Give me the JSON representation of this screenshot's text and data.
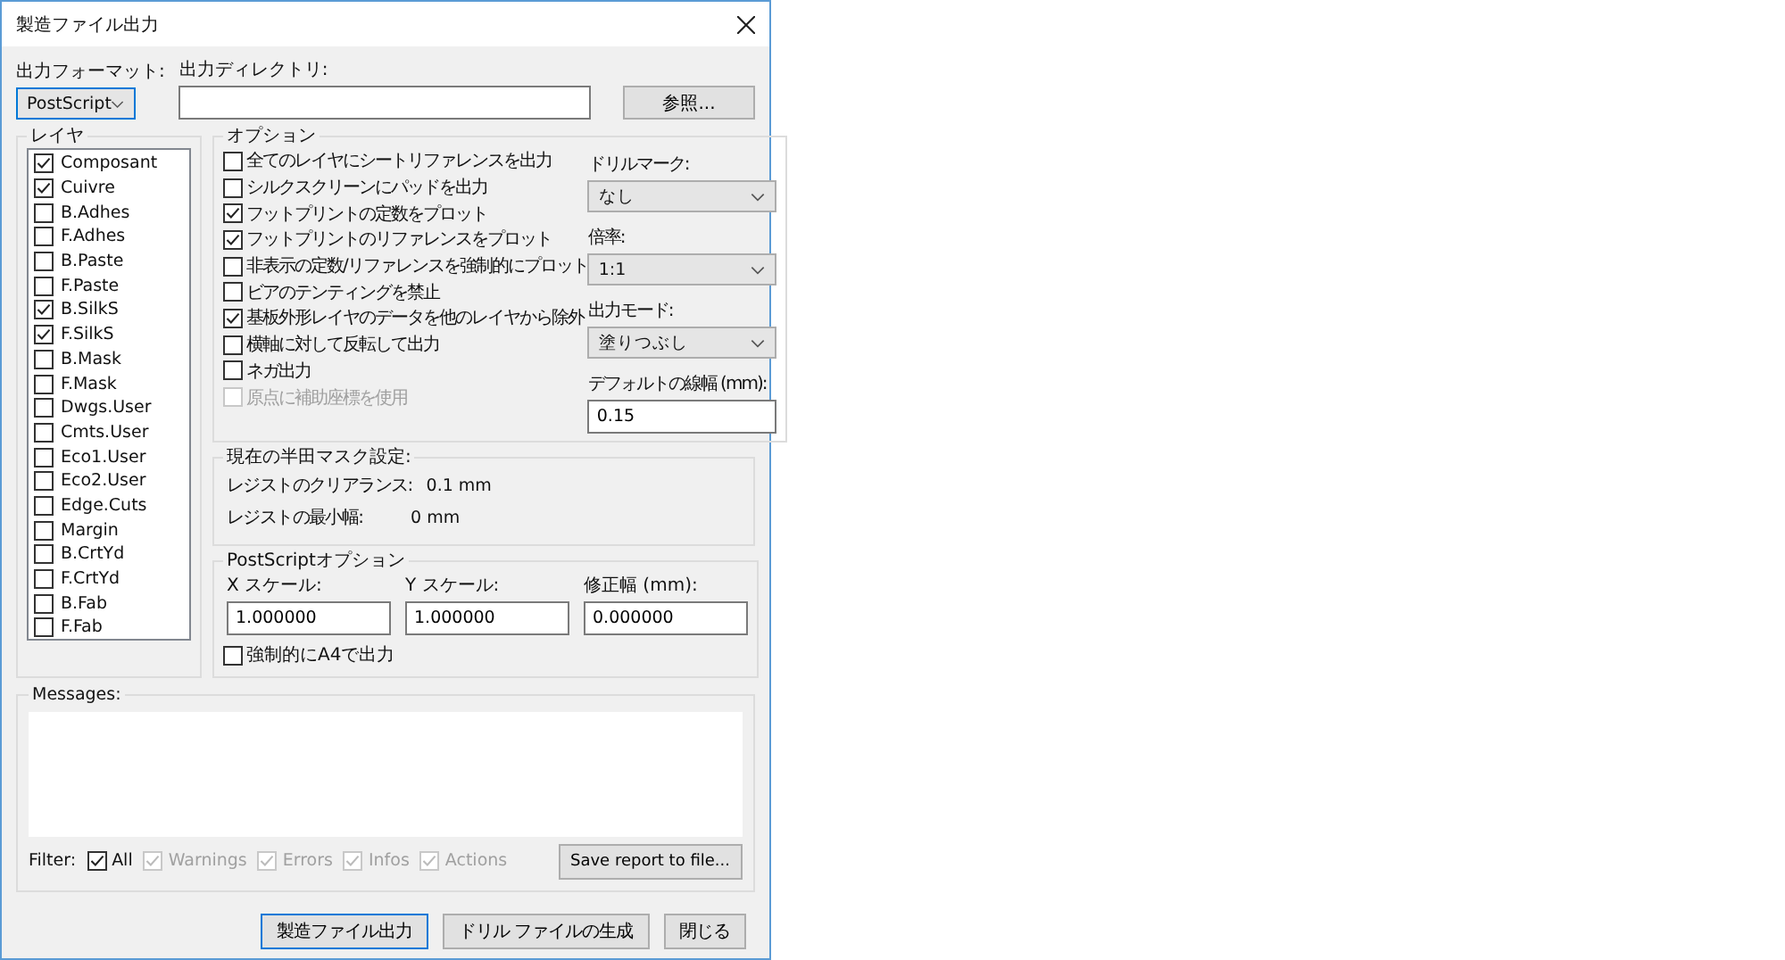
{
  "window": {
    "title": "製造ファイル出力"
  },
  "output_format": {
    "label": "出力フォーマット:",
    "value": "PostScript"
  },
  "output_directory": {
    "label": "出力ディレクトリ:"
  },
  "browse_button": "参照...",
  "layers": {
    "title": "レイヤ",
    "items": [
      {
        "label": "Composant",
        "checked": true
      },
      {
        "label": "Cuivre",
        "checked": true
      },
      {
        "label": "B.Adhes",
        "checked": false
      },
      {
        "label": "F.Adhes",
        "checked": false
      },
      {
        "label": "B.Paste",
        "checked": false
      },
      {
        "label": "F.Paste",
        "checked": false
      },
      {
        "label": "B.SilkS",
        "checked": true
      },
      {
        "label": "F.SilkS",
        "checked": true
      },
      {
        "label": "B.Mask",
        "checked": false
      },
      {
        "label": "F.Mask",
        "checked": false
      },
      {
        "label": "Dwgs.User",
        "checked": false
      },
      {
        "label": "Cmts.User",
        "checked": false
      },
      {
        "label": "Eco1.User",
        "checked": false
      },
      {
        "label": "Eco2.User",
        "checked": false
      },
      {
        "label": "Edge.Cuts",
        "checked": false
      },
      {
        "label": "Margin",
        "checked": false
      },
      {
        "label": "B.CrtYd",
        "checked": false
      },
      {
        "label": "F.CrtYd",
        "checked": false
      },
      {
        "label": "B.Fab",
        "checked": false
      },
      {
        "label": "F.Fab",
        "checked": false
      }
    ]
  },
  "options": {
    "title": "オプション",
    "items": [
      {
        "label": "全てのレイヤにシートリファレンスを出力",
        "checked": false,
        "disabled": false
      },
      {
        "label": "シルクスクリーンにパッドを出力",
        "checked": false,
        "disabled": false
      },
      {
        "label": "フットプリントの定数をプロット",
        "checked": true,
        "disabled": false
      },
      {
        "label": "フットプリントのリファレンスをプロット",
        "checked": true,
        "disabled": false
      },
      {
        "label": "非表示の定数/リファレンスを強制的にプロット",
        "checked": false,
        "disabled": false
      },
      {
        "label": "ビアのテンティングを禁止",
        "checked": false,
        "disabled": false
      },
      {
        "label": "基板外形レイヤのデータを他のレイヤから除外",
        "checked": true,
        "disabled": false
      },
      {
        "label": "横軸に対して反転して出力",
        "checked": false,
        "disabled": false
      },
      {
        "label": "ネガ出力",
        "checked": false,
        "disabled": false
      },
      {
        "label": "原点に補助座標を使用",
        "checked": false,
        "disabled": true
      }
    ],
    "selects": [
      {
        "label": "ドリルマーク:",
        "value": "なし"
      },
      {
        "label": "倍率:",
        "value": "1:1"
      },
      {
        "label": "出力モード:",
        "value": "塗りつぶし"
      }
    ],
    "line_width": {
      "label": "デフォルトの線幅 (mm):",
      "value": "0.15"
    }
  },
  "solder_mask": {
    "title": "現在の半田マスク設定:",
    "rows": [
      {
        "label": "レジストのクリアランス:",
        "value": "0.1 mm"
      },
      {
        "label": "レジストの最小幅:",
        "value": "0 mm"
      }
    ]
  },
  "postscript": {
    "title": "PostScriptオプション",
    "fields": [
      {
        "label": "X スケール:",
        "value": "1.000000"
      },
      {
        "label": "Y スケール:",
        "value": "1.000000"
      },
      {
        "label": "修正幅 (mm):",
        "value": "0.000000"
      }
    ],
    "force_a4": {
      "label": "強制的にA4で出力",
      "checked": false
    }
  },
  "messages": {
    "title": "Messages:",
    "filter_label": "Filter:",
    "filters": [
      {
        "label": "All",
        "checked": true,
        "disabled": false
      },
      {
        "label": "Warnings",
        "checked": true,
        "disabled": true
      },
      {
        "label": "Errors",
        "checked": true,
        "disabled": true
      },
      {
        "label": "Infos",
        "checked": true,
        "disabled": true
      },
      {
        "label": "Actions",
        "checked": true,
        "disabled": true
      }
    ],
    "save_button": "Save report to file..."
  },
  "buttons": [
    {
      "label": "製造ファイル出力",
      "default": true
    },
    {
      "label": "ドリル ファイルの生成",
      "default": false
    },
    {
      "label": "閉じる",
      "default": false
    }
  ]
}
